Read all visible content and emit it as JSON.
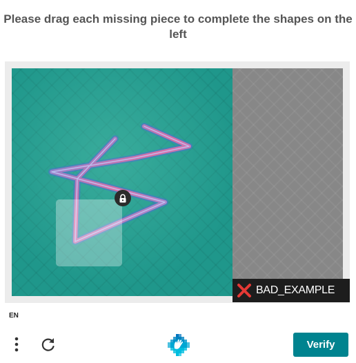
{
  "prompt": {
    "text": "Please drag each missing piece to complete the shapes on the left"
  },
  "challenge": {
    "watermark": "BAD_EXAMPLE",
    "board_color": "#1f978b",
    "tray_color": "#878787"
  },
  "footer": {
    "language": "EN",
    "verify_label": "Verify",
    "menu_icon": "vertical-dots-icon",
    "refresh_icon": "refresh-icon",
    "logo_icon": "hcaptcha-logo-icon",
    "accent_color": "#00838f"
  }
}
